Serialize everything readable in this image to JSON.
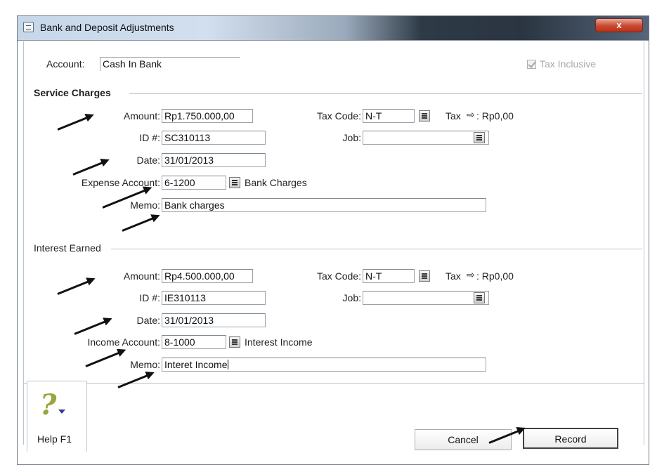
{
  "window": {
    "title": "Bank and Deposit Adjustments",
    "close_label": "x"
  },
  "account": {
    "label": "Account:",
    "value": "Cash In Bank"
  },
  "tax_inclusive": {
    "label": "Tax Inclusive",
    "checked": true
  },
  "service_charges": {
    "section_title": "Service Charges",
    "amount_label": "Amount:",
    "amount": "Rp1.750.000,00",
    "id_label": "ID #:",
    "id": "SC310113",
    "date_label": "Date:",
    "date": "31/01/2013",
    "account_label": "Expense Account:",
    "account_number": "6-1200",
    "account_name": "Bank Charges",
    "memo_label": "Memo:",
    "memo": "Bank charges",
    "tax_code_label": "Tax Code:",
    "tax_code": "N-T",
    "tax_label": "Tax",
    "tax_value": ": Rp0,00",
    "job_label": "Job:",
    "job": ""
  },
  "interest_earned": {
    "section_title": "Interest Earned",
    "amount_label": "Amount:",
    "amount": "Rp4.500.000,00",
    "id_label": "ID #:",
    "id": "IE310113",
    "date_label": "Date:",
    "date": "31/01/2013",
    "account_label": "Income Account:",
    "account_number": "8-1000",
    "account_name": "Interest Income",
    "memo_label": "Memo:",
    "memo": "Interet Income",
    "tax_code_label": "Tax Code:",
    "tax_code": "N-T",
    "tax_label": "Tax",
    "tax_value": ": Rp0,00",
    "job_label": "Job:",
    "job": ""
  },
  "footer": {
    "help_label": "Help F1",
    "cancel_label": "Cancel",
    "record_label": "Record"
  }
}
